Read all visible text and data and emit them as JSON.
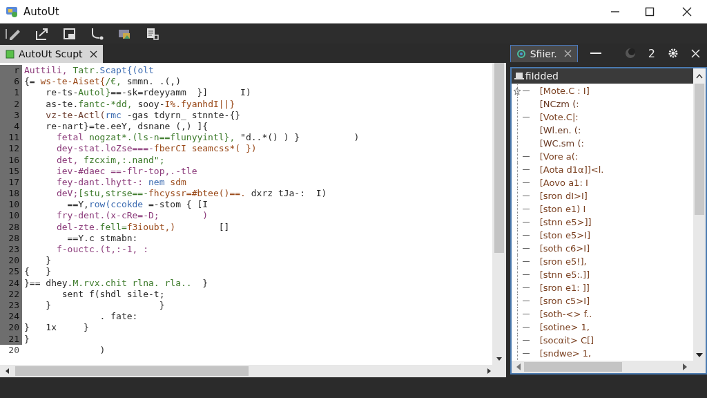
{
  "window": {
    "title": "AutoUt"
  },
  "editor": {
    "tab": {
      "label": "AutoUt Scupt",
      "selected": true
    },
    "lines": [
      {
        "number": "r",
        "current": false,
        "tokens": [
          {
            "text": "Auttili,",
            "color": "#8b3a7a"
          },
          {
            "text": " Tatr.",
            "color": "#3c7a2a"
          },
          {
            "text": "Scapt{(olt",
            "color": "#3a6ab0"
          }
        ]
      },
      {
        "number": "6",
        "current": false,
        "tokens": [
          {
            "text": "{= ",
            "color": "#2a2a2a"
          },
          {
            "text": "ws-te-Aiset{",
            "color": "#9a4a1a"
          },
          {
            "text": "/€, ",
            "color": "#3c7a2a"
          },
          {
            "text": "smmn. .(,)",
            "color": "#2a2a2a"
          }
        ]
      },
      {
        "number": "1",
        "current": false,
        "tokens": [
          {
            "text": "    re-ts-",
            "color": "#2a2a2a"
          },
          {
            "text": "Autol}",
            "color": "#3c7a2a"
          },
          {
            "text": "==-sk=rdeyyamm  }]      I)",
            "color": "#2a2a2a"
          }
        ]
      },
      {
        "number": "2",
        "current": false,
        "tokens": [
          {
            "text": "    as-te.",
            "color": "#2a2a2a"
          },
          {
            "text": "fantc-*dd,",
            "color": "#3c7a2a"
          },
          {
            "text": " sooy-",
            "color": "#2a2a2a"
          },
          {
            "text": "I%.fyanhdI||}",
            "color": "#9a4a1a"
          }
        ]
      },
      {
        "number": "3",
        "current": false,
        "tokens": [
          {
            "text": "    vz-te-Actl(",
            "color": "#6a3a2a"
          },
          {
            "text": "rmc",
            "color": "#3a6ab0"
          },
          {
            "text": " -gas tdyrn_ stnnte-{}",
            "color": "#2a2a2a"
          }
        ]
      },
      {
        "number": "4",
        "current": false,
        "tokens": [
          {
            "text": "    re-nart}=te.eeY, dsnane (,) ]{",
            "color": "#2a2a2a"
          }
        ]
      },
      {
        "number": "11",
        "current": false,
        "tokens": [
          {
            "text": "      fetal ",
            "color": "#8b3a7a"
          },
          {
            "text": "nogzat*.(ls-n==flunyyintl},",
            "color": "#3c7a2a"
          },
          {
            "text": " \"d..*() ) }          )",
            "color": "#2a2a2a"
          }
        ]
      },
      {
        "number": "12",
        "current": false,
        "tokens": [
          {
            "text": "      dey-stat.loZse===-",
            "color": "#8b3a7a"
          },
          {
            "text": "fberCI seamcss*( })",
            "color": "#9a4a1a"
          }
        ]
      },
      {
        "number": "16",
        "current": false,
        "tokens": [
          {
            "text": "      det, ",
            "color": "#8b3a7a"
          },
          {
            "text": "fzcxim,:.nand\";",
            "color": "#3c7a2a"
          }
        ]
      },
      {
        "number": "15",
        "current": false,
        "tokens": [
          {
            "text": "      iev-#daec ==-flr-top,.-tle",
            "color": "#8b3a7a"
          }
        ]
      },
      {
        "number": "17",
        "current": false,
        "tokens": [
          {
            "text": "      fey-dant.lhytt-: ",
            "color": "#8b3a7a"
          },
          {
            "text": "nem",
            "color": "#3a6ab0"
          },
          {
            "text": " sdm",
            "color": "#9a4a1a"
          }
        ]
      },
      {
        "number": "18",
        "current": false,
        "tokens": [
          {
            "text": "      deV;",
            "color": "#8b3a7a"
          },
          {
            "text": "[stu,strse==-",
            "color": "#3c7a2a"
          },
          {
            "text": "fhcyssr=#btee()==.",
            "color": "#9a4a1a"
          },
          {
            "text": " dxrz tJa-:  I)",
            "color": "#2a2a2a"
          }
        ]
      },
      {
        "number": "10",
        "current": false,
        "tokens": [
          {
            "text": "        ==Y,",
            "color": "#2a2a2a"
          },
          {
            "text": "row(ccokde",
            "color": "#3a6ab0"
          },
          {
            "text": " =-stom { [I",
            "color": "#2a2a2a"
          }
        ]
      },
      {
        "number": "10",
        "current": false,
        "tokens": [
          {
            "text": "      fry-dent.(x-cRe=-D;        )",
            "color": "#8b3a7a"
          }
        ]
      },
      {
        "number": "28",
        "current": false,
        "tokens": [
          {
            "text": "      del-zte.",
            "color": "#8b3a7a"
          },
          {
            "text": "fell=",
            "color": "#3c7a2a"
          },
          {
            "text": "f3ioubt,)",
            "color": "#9a4a1a"
          },
          {
            "text": "        []",
            "color": "#2a2a2a"
          }
        ]
      },
      {
        "number": "28",
        "current": false,
        "tokens": [
          {
            "text": "        ==Y.c stmabn:",
            "color": "#2a2a2a"
          }
        ]
      },
      {
        "number": "23",
        "current": false,
        "tokens": [
          {
            "text": "      f-ouctc.(t,:-1, :",
            "color": "#8b3a7a"
          }
        ]
      },
      {
        "number": "20",
        "current": false,
        "tokens": [
          {
            "text": "    }"
          }
        ]
      },
      {
        "number": "25",
        "current": false,
        "tokens": [
          {
            "text": "{   }"
          }
        ]
      },
      {
        "number": "24",
        "current": false,
        "tokens": [
          {
            "text": "}== dhey.",
            "color": "#2a2a2a"
          },
          {
            "text": "M.rvx.chit rlna. rla..",
            "color": "#3c7a2a"
          },
          {
            "text": "  }",
            "color": "#2a2a2a"
          }
        ]
      },
      {
        "number": "22",
        "current": false,
        "tokens": [
          {
            "text": "       sent f(shdl sile-t;",
            "color": "#2a2a2a"
          }
        ]
      },
      {
        "number": "23",
        "current": false,
        "tokens": [
          {
            "text": "    }                    }",
            "color": "#2a2a2a"
          }
        ]
      },
      {
        "number": "24",
        "current": false,
        "tokens": [
          {
            "text": "              . fate:",
            "color": "#2a2a2a"
          }
        ]
      },
      {
        "number": "20",
        "current": false,
        "tokens": [
          {
            "text": "}   1x     }",
            "color": "#2a2a2a"
          }
        ]
      },
      {
        "number": "21",
        "current": false,
        "tokens": [
          {
            "text": "}"
          }
        ]
      },
      {
        "number": "20",
        "current": true,
        "tokens": [
          {
            "text": "              )"
          }
        ]
      }
    ]
  },
  "side_panel": {
    "tab": {
      "label": "Sfiier.",
      "selected": true
    },
    "count": "2",
    "header": "fiIdded",
    "tree": [
      {
        "label": "[Mote.C : I]",
        "selected": true,
        "children": [
          {
            "label": "[NCzm (:"
          }
        ]
      },
      {
        "label": "[Vote.C|:",
        "selected": false,
        "children": [
          {
            "label": "[Wl.en. (:"
          },
          {
            "label": "[WC.sm (:"
          }
        ]
      },
      {
        "label": "[Vore a(:",
        "selected": false
      },
      {
        "label": "[Aota d1α]]<l.",
        "selected": false
      },
      {
        "label": "[Aovo a1: I",
        "selected": false
      },
      {
        "label": "[sron dI>I]",
        "selected": false
      },
      {
        "label": "[ston e1) I",
        "selected": false
      },
      {
        "label": "[stnn e5>]]",
        "selected": false
      },
      {
        "label": "[ston e5>I]",
        "selected": false
      },
      {
        "label": "[soth c6>I]",
        "selected": false
      },
      {
        "label": "[sron e5!],",
        "selected": false
      },
      {
        "label": "[stnn e5:.]]",
        "selected": false
      },
      {
        "label": "[sron e1: ]]",
        "selected": false
      },
      {
        "label": "[sron c5>I]",
        "selected": false
      },
      {
        "label": "[soth-<> f..",
        "selected": false
      },
      {
        "label": "[sotine> 1,",
        "selected": false
      },
      {
        "label": "[socαit> C[]",
        "selected": false
      },
      {
        "label": "[sndwe> 1,",
        "selected": false
      }
    ]
  }
}
